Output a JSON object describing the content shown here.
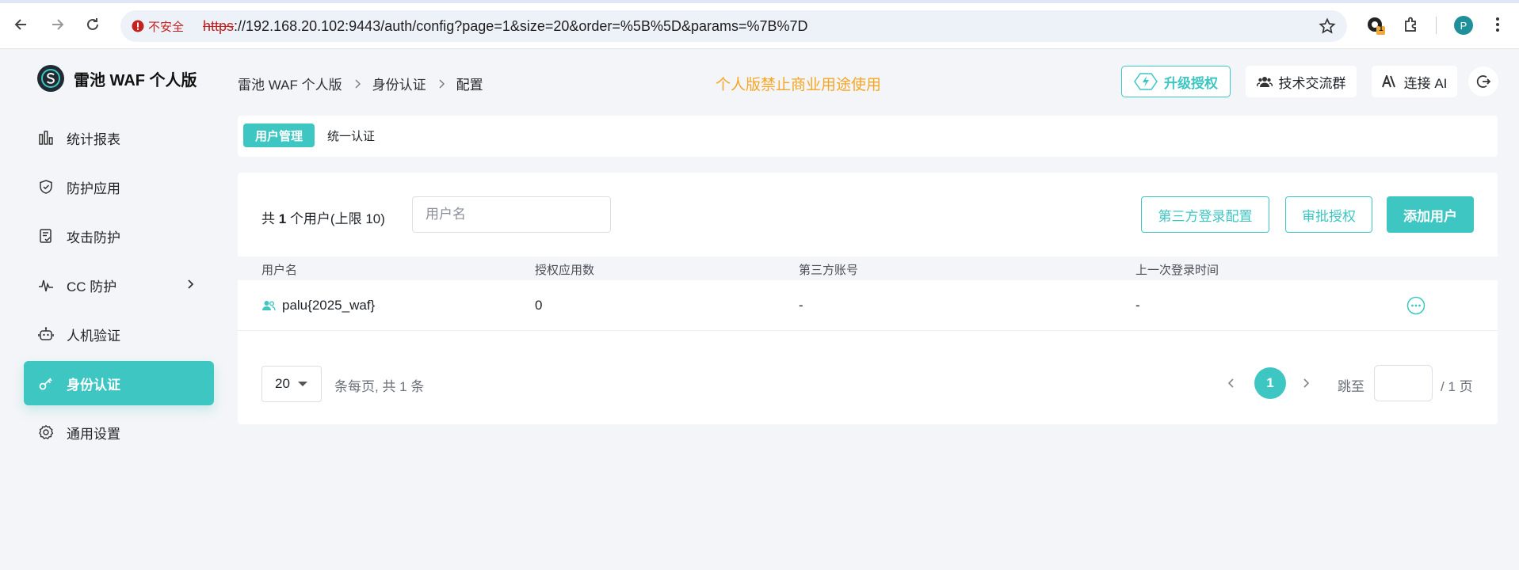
{
  "browser": {
    "insecure_label": "不安全",
    "url_scheme": "https",
    "url_rest": "://192.168.20.102:9443/auth/config?page=1&size=20&order=%5B%5D&params=%7B%7D",
    "extension_badge": "1",
    "profile_initial": "P"
  },
  "app": {
    "name": "雷池 WAF 个人版"
  },
  "sidebar": {
    "items": [
      {
        "label": "统计报表",
        "icon": "bar-chart-icon"
      },
      {
        "label": "防护应用",
        "icon": "shield-icon"
      },
      {
        "label": "攻击防护",
        "icon": "document-check-icon"
      },
      {
        "label": "CC 防护",
        "icon": "pulse-icon"
      },
      {
        "label": "人机验证",
        "icon": "robot-icon"
      },
      {
        "label": "身份认证",
        "icon": "key-icon"
      },
      {
        "label": "通用设置",
        "icon": "gear-icon"
      }
    ],
    "active_index": 5
  },
  "header": {
    "breadcrumb": [
      "雷池 WAF 个人版",
      "身份认证",
      "配置"
    ],
    "notice": "个人版禁止商业用途使用",
    "upgrade_label": "升级授权",
    "community_label": "技术交流群",
    "ai_label": "连接 AI"
  },
  "tabs": [
    {
      "label": "用户管理",
      "active": true
    },
    {
      "label": "统一认证",
      "active": false
    }
  ],
  "users": {
    "count_prefix": "共",
    "count_value": "1",
    "count_suffix": "个用户(上限 10)",
    "search_placeholder": "用户名",
    "third_party_button": "第三方登录配置",
    "approve_button": "审批授权",
    "add_button": "添加用户",
    "columns": [
      "用户名",
      "授权应用数",
      "第三方账号",
      "上一次登录时间"
    ],
    "rows": [
      {
        "username": "palu{2025_waf}",
        "app_count": "0",
        "third_party": "-",
        "last_login": "-"
      }
    ]
  },
  "pagination": {
    "page_size": "20",
    "summary": "条每页, 共 1 条",
    "current_page": "1",
    "jump_label": "跳至",
    "total_pages": "/ 1 页"
  },
  "colors": {
    "accent": "#3ec6c2",
    "notice": "#f5a623"
  }
}
